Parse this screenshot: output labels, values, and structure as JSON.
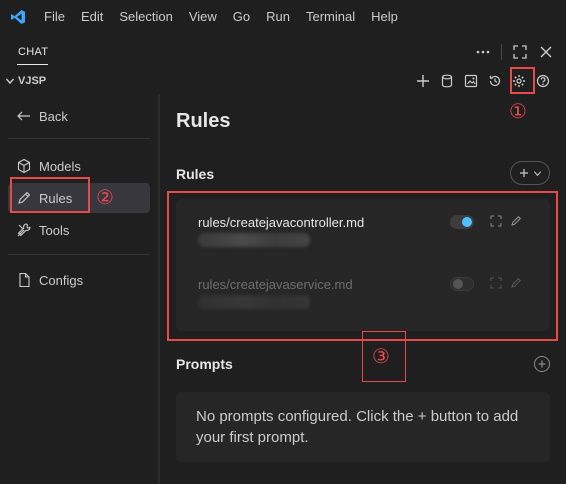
{
  "menu": [
    "File",
    "Edit",
    "Selection",
    "View",
    "Go",
    "Run",
    "Terminal",
    "Help"
  ],
  "panel": {
    "tab": "CHAT",
    "workspace": "VJSP"
  },
  "icons": {
    "title": [
      "vscode-logo-icon"
    ],
    "header": [
      "more-icon",
      "maximize-icon",
      "close-icon"
    ],
    "workspace": [
      "add-icon",
      "database-icon",
      "image-icon",
      "history-icon",
      "settings-icon",
      "help-icon"
    ],
    "sidebar": [
      "arrow-left-icon",
      "cube-icon",
      "pencil-icon",
      "tools-icon",
      "file-icon"
    ]
  },
  "sidebar": {
    "back": "Back",
    "items": [
      {
        "label": "Models"
      },
      {
        "label": "Rules"
      },
      {
        "label": "Tools"
      },
      {
        "label": "Configs"
      }
    ]
  },
  "main": {
    "title": "Rules",
    "rules_heading": "Rules",
    "rules": [
      {
        "name": "rules/createjavacontroller.md",
        "enabled": true
      },
      {
        "name": "rules/createjavaservice.md",
        "enabled": false
      }
    ],
    "prompts_heading": "Prompts",
    "prompts_empty": "No prompts configured. Click the + button to add your first prompt."
  },
  "annotations": [
    "①",
    "②",
    "③"
  ],
  "colors": {
    "accent": "#4fc1ff",
    "annotation": "#e84a4a",
    "vscode_logo": "#3ea6ff"
  }
}
